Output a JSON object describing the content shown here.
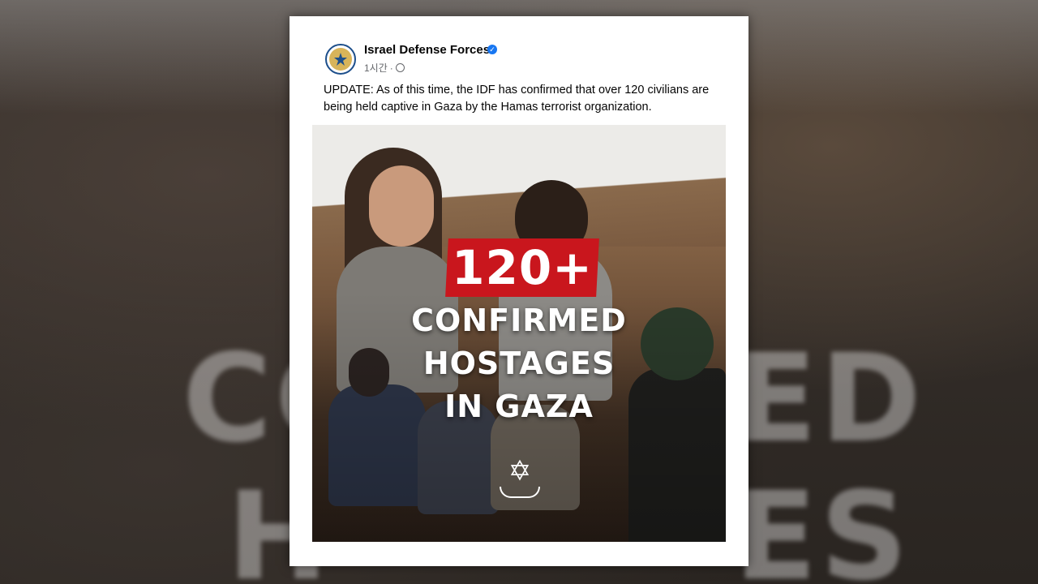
{
  "post": {
    "page_name": "Israel Defense Forces",
    "time": "1시간",
    "separator": "·",
    "text": "UPDATE: As of this time, the IDF has confirmed that over 120 civilians are being held captive in Gaza by the Hamas terrorist organization."
  },
  "image": {
    "badge": "120+",
    "headline_lines": [
      "CONFIRMED",
      "HOSTAGES",
      "IN GAZA"
    ]
  },
  "background": {
    "text_fragments": [
      "CO",
      "ED",
      "H",
      "ES"
    ]
  },
  "colors": {
    "badge_red": "#c9161d",
    "verified_blue": "#1877f2",
    "card_bg": "#ffffff"
  },
  "icons": {
    "verified": "verified-badge-icon",
    "privacy": "globe-icon",
    "avatar": "idf-emblem-icon"
  }
}
